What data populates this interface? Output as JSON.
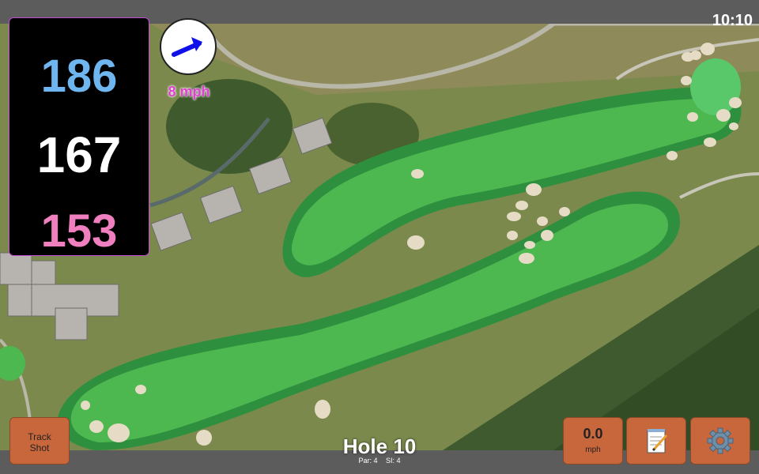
{
  "status": {
    "time": "10:10"
  },
  "distances": {
    "back": "186",
    "middle": "167",
    "front": "153"
  },
  "wind": {
    "speed": "8 mph",
    "icon": "wind-arrow-icon"
  },
  "hole": {
    "title": "Hole 10",
    "par": "Par: 4",
    "si": "SI: 4"
  },
  "buttons": {
    "track_shot_line1": "Track",
    "track_shot_line2": "Shot",
    "speed_value": "0.0",
    "speed_unit": "mph",
    "notes_icon": "notepad-icon",
    "settings_icon": "gear-icon"
  },
  "colors": {
    "back": "#6fb5f0",
    "middle": "#ffffff",
    "front": "#f07fc0",
    "wind_text": "#e03fd0",
    "button": "#c9673c"
  }
}
